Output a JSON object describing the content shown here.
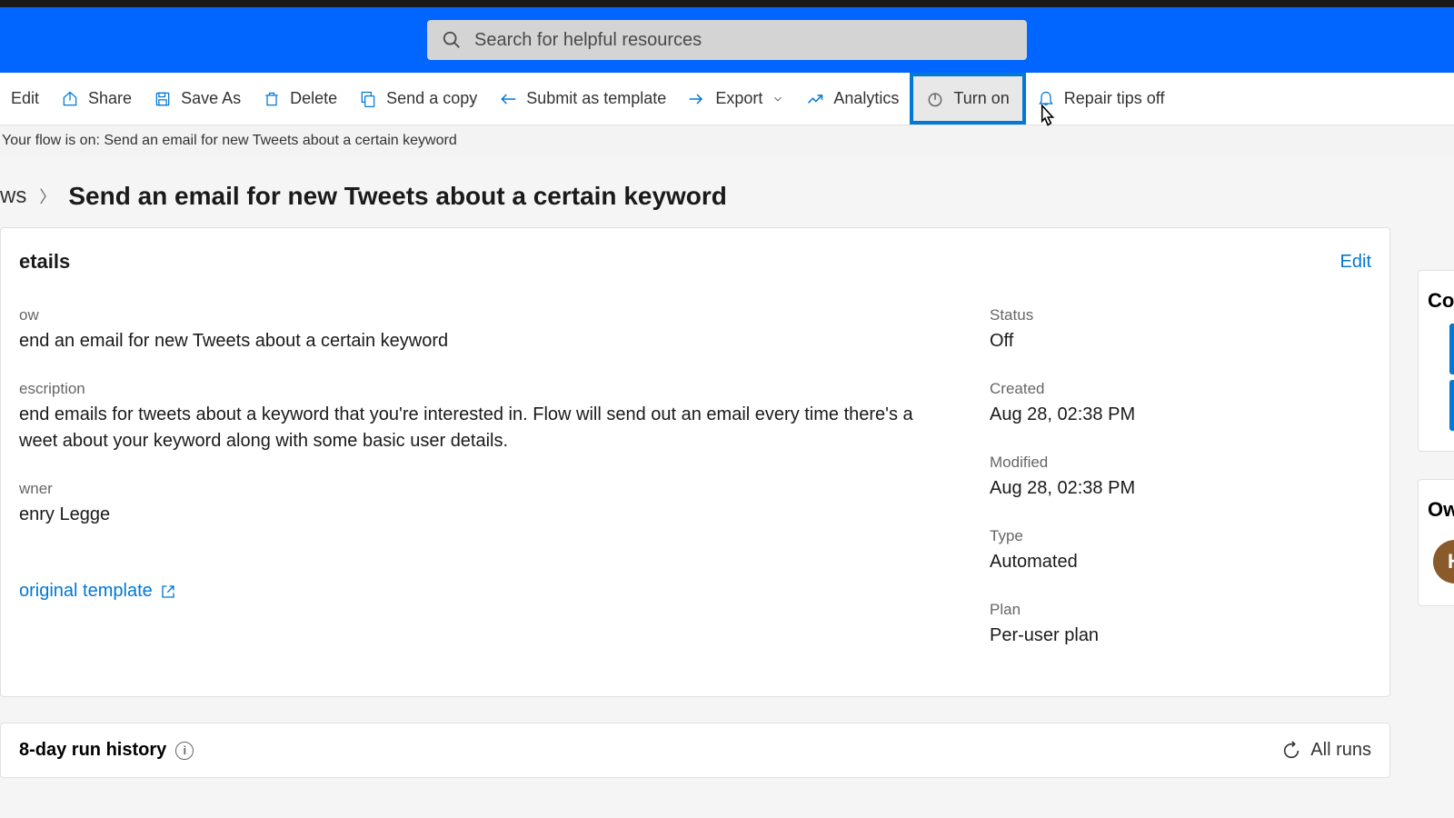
{
  "search": {
    "placeholder": "Search for helpful resources"
  },
  "toolbar": {
    "edit": "Edit",
    "share": "Share",
    "save_as": "Save As",
    "delete": "Delete",
    "send_copy": "Send a copy",
    "submit_template": "Submit as template",
    "export": "Export",
    "analytics": "Analytics",
    "turn_on": "Turn on",
    "repair_tips": "Repair tips off"
  },
  "status_message": "Your flow is on: Send an email for new Tweets about a certain keyword",
  "breadcrumb": {
    "root": "ws",
    "title": "Send an email for new Tweets about a certain keyword"
  },
  "details": {
    "section_title": "etails",
    "edit_link": "Edit",
    "flow": {
      "label": "ow",
      "value": "end an email for new Tweets about a certain keyword"
    },
    "description": {
      "label": "escription",
      "value": "end emails for tweets about a keyword that you're interested in. Flow will send out an email every time there's a weet about your keyword along with some basic user details."
    },
    "owner": {
      "label": "wner",
      "value": "enry Legge"
    },
    "status": {
      "label": "Status",
      "value": "Off"
    },
    "created": {
      "label": "Created",
      "value": "Aug 28, 02:38 PM"
    },
    "modified": {
      "label": "Modified",
      "value": "Aug 28, 02:38 PM"
    },
    "type": {
      "label": "Type",
      "value": "Automated"
    },
    "plan": {
      "label": "Plan",
      "value": "Per-user plan"
    },
    "template_link": "original template"
  },
  "history": {
    "title": "8-day run history",
    "all_runs": "All runs"
  },
  "side": {
    "co_label": "Co",
    "ow_label": "Ow",
    "avatar_initial": "H"
  }
}
